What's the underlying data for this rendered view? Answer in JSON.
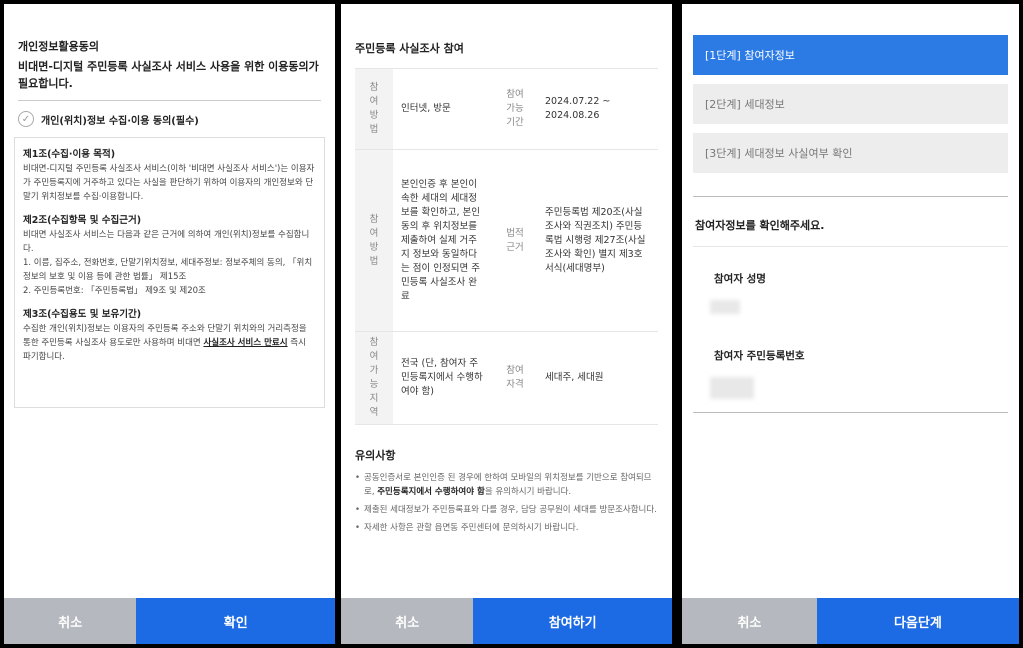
{
  "panel1": {
    "title": "개인정보활용동의",
    "subtitle": "비대면-디지털 주민등록 사실조사 서비스 사용을 위한 이용동의가 필요합니다.",
    "consent_label": "개인(위치)정보 수집·이용 동의(필수)",
    "sections": [
      {
        "title": "제1조(수집·이용 목적)",
        "body": "비대면-디지털 주민등록 사실조사 서비스(이하 '비대면 사실조사 서비스')는 이용자가 주민등록지에 거주하고 있다는 사실을 판단하기 위하여 이용자의 개인정보와 단말기 위치정보를 수집·이용합니다."
      },
      {
        "title": "제2조(수집항목 및 수집근거)",
        "body_lines": [
          "비대면 사실조사 서비스는 다음과 같은 근거에 의하여 개인(위치)정보를 수집합니다.",
          "1. 이름, 집주소, 전화번호, 단말기위치정보, 세대주정보: 정보주체의 동의, 「위치정보의 보호 및 이용 등에 관한 법률」 제15조",
          "2. 주민등록번호: 「주민등록법」 제9조 및 제20조"
        ]
      },
      {
        "title": "제3조(수집용도 및 보유기간)",
        "body_pre": "수집한 개인(위치)정보는 이용자의 주민등록 주소와 단말기 위치와의 거리측정을 통한 주민등록 사실조사 용도로만 사용하며 비대면 ",
        "body_emph": "사실조사 서비스 만료시",
        "body_post": " 즉시 파기합니다."
      }
    ],
    "cancel_label": "취소",
    "confirm_label": "확인"
  },
  "panel2": {
    "title": "주민등록 사실조사 참여",
    "rows": [
      {
        "label1": "참여방법",
        "value1": "인터넷, 방문",
        "label2": "참여가능기간",
        "value2": "2024.07.22 ~ 2024.08.26"
      },
      {
        "label1": "참여방법",
        "value1": "본인인증 후 본인이 속한 세대의 세대정보를 확인하고, 본인 동의 후 위치정보를 제출하여 실제 거주지 정보와 동일하다는 점이 인정되면 주민등록 사실조사 완료",
        "label2": "법적근거",
        "value2": "주민등록법 제20조(사실조사와 직권조치) 주민등록법 시행령 제27조(사실조사와 확인) 별지 제3호서식(세대명부)"
      },
      {
        "label1": "참여가능지역",
        "value1": "전국 (단, 참여자 주민등록지에서 수행하여야 함)",
        "label2": "참여자격",
        "value2": "세대주, 세대원"
      }
    ],
    "notes_title": "유의사항",
    "notes": [
      {
        "pre": "공동인증서로 본인인증 된 경우에 한하여 모바일의 위치정보를 기반으로 참여되므로, ",
        "emph": "주민등록지에서 수행하여야 함",
        "post": "을 유의하시기 바랍니다."
      },
      {
        "pre": "제출된 세대정보가 주민등록표와 다를 경우, 담당 공무원이 세대를 방문조사합니다.",
        "emph": "",
        "post": ""
      },
      {
        "pre": "자세한 사항은 관할 읍면동 주민센터에 문의하시기 바랍니다.",
        "emph": "",
        "post": ""
      }
    ],
    "cancel_label": "취소",
    "join_label": "참여하기"
  },
  "panel3": {
    "steps": [
      "[1단계] 참여자정보",
      "[2단계] 세대정보",
      "[3단계] 세대정보 사실여부 확인"
    ],
    "confirm_text": "참여자정보를 확인해주세요.",
    "name_label": "참여자 성명",
    "rrn_label": "참여자 주민등록번호",
    "cancel_label": "취소",
    "next_label": "다음단계",
    "colors": {
      "active_step": "#2c7be5",
      "primary": "#1c6ae4",
      "cancel": "#b5b9bf"
    }
  }
}
